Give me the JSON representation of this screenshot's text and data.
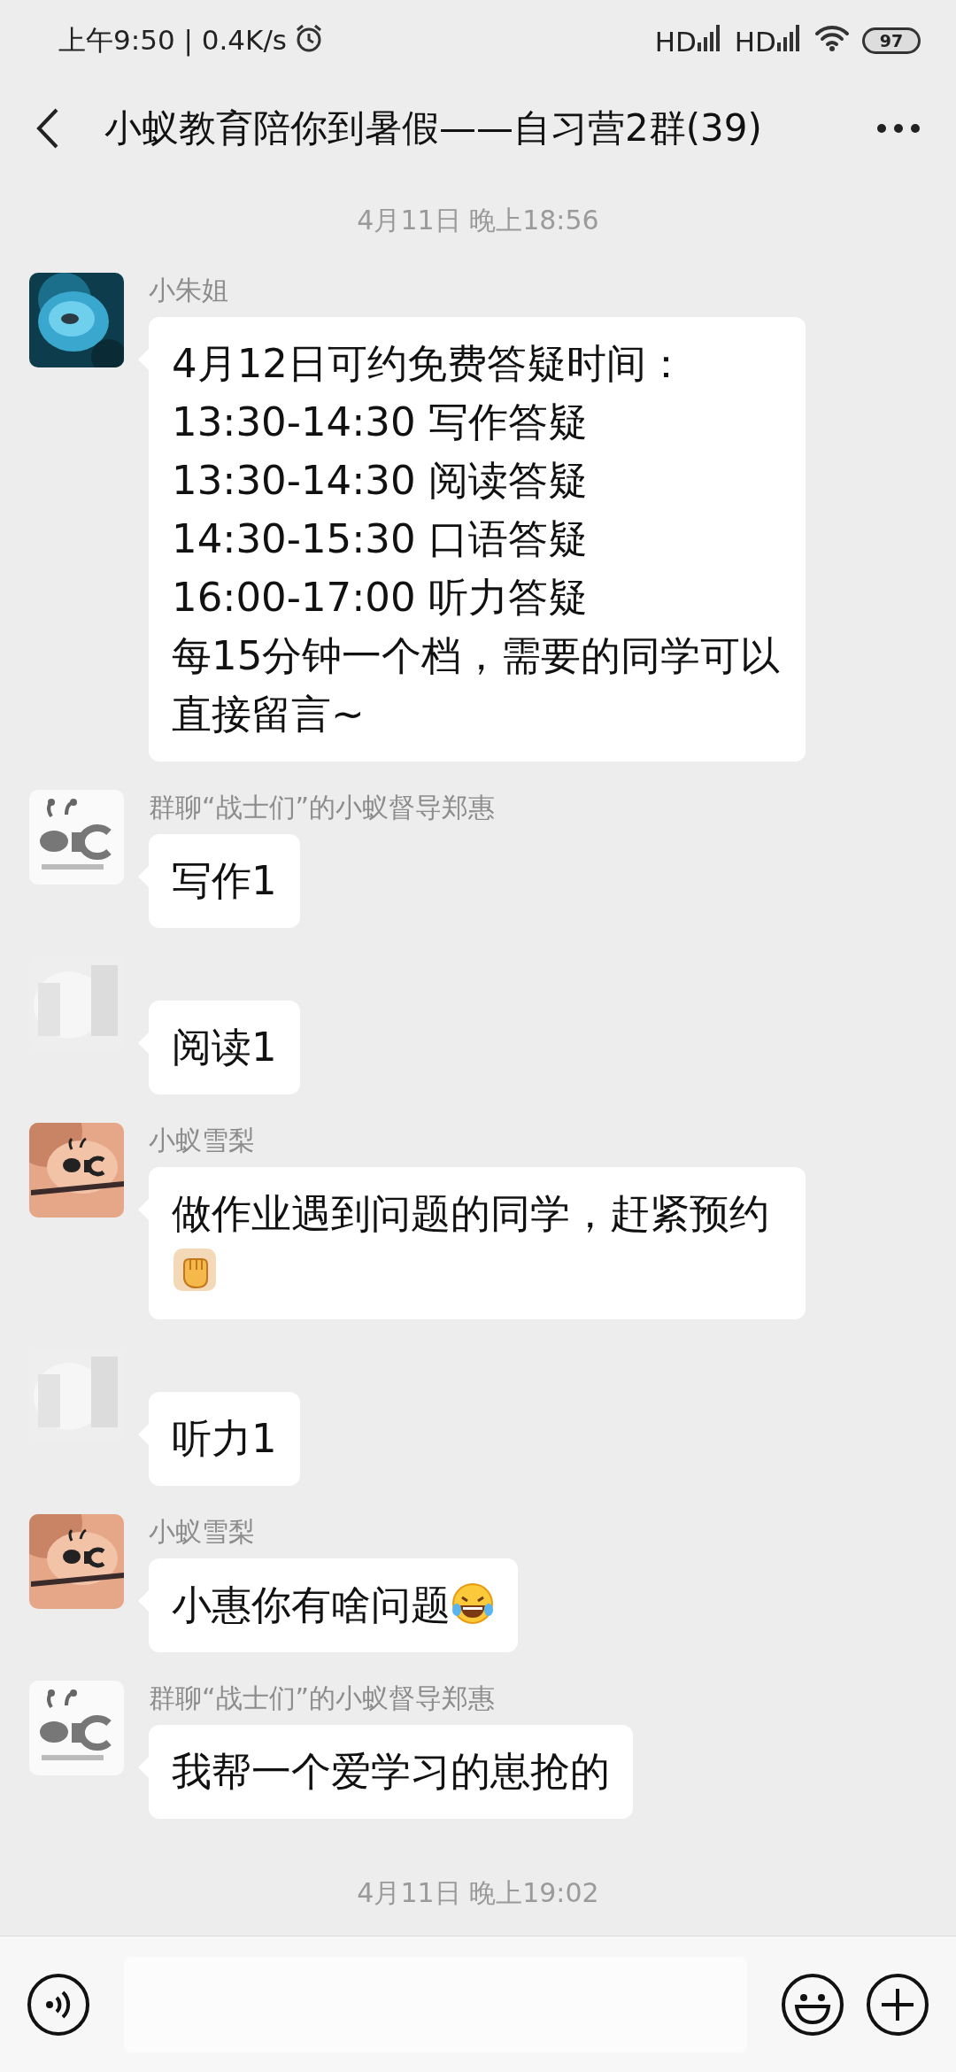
{
  "status_bar": {
    "text": "上午9:50 | 0.4K/s",
    "network_labels": [
      "HD",
      "HD"
    ],
    "battery": "97"
  },
  "header": {
    "title": "小蚁教育陪你到暑假——自习营2群(39)"
  },
  "items": [
    {
      "kind": "timestamp",
      "text": "4月11日 晚上18:56"
    },
    {
      "kind": "message",
      "sender": "小朱姐",
      "lines": [
        "4月12日可约免费答疑时间：",
        "13:30-14:30 写作答疑",
        "13:30-14:30 阅读答疑",
        "14:30-15:30 口语答疑",
        "16:00-17:00 听力答疑",
        "每15分钟一个档，需要的同学可以直接留言~"
      ]
    },
    {
      "kind": "message",
      "avatar": {
        "kind": "logo"
      },
      "sender": "群聊“战士们”的小蚁督导郑惠",
      "lines": [
        "写作1"
      ]
    },
    {
      "kind": "message",
      "avatar": {
        "kind": "blurred"
      },
      "lines": [
        "阅读1"
      ]
    },
    {
      "kind": "message",
      "avatar": {
        "kind": "poster"
      },
      "sender": "小蚁雪梨",
      "lines": [
        "做作业遇到问题的同学，赶紧预约"
      ],
      "emoji": {
        "kind": "fist"
      }
    },
    {
      "kind": "message",
      "avatar": {
        "kind": "blurred"
      },
      "lines": [
        "听力1"
      ]
    },
    {
      "kind": "message",
      "avatar": {
        "kind": "poster"
      },
      "sender": "小蚁雪梨",
      "lines": [
        "小惠你有啥问题"
      ],
      "emoji": {
        "kind": "laugh"
      }
    },
    {
      "kind": "message",
      "avatar": {
        "kind": "logo"
      },
      "sender": "群聊“战士们”的小蚁督导郑惠",
      "lines": [
        "我帮一个爱学习的崽抢的"
      ]
    },
    {
      "kind": "timestamp",
      "text": "4月11日 晚上19:02"
    }
  ]
}
